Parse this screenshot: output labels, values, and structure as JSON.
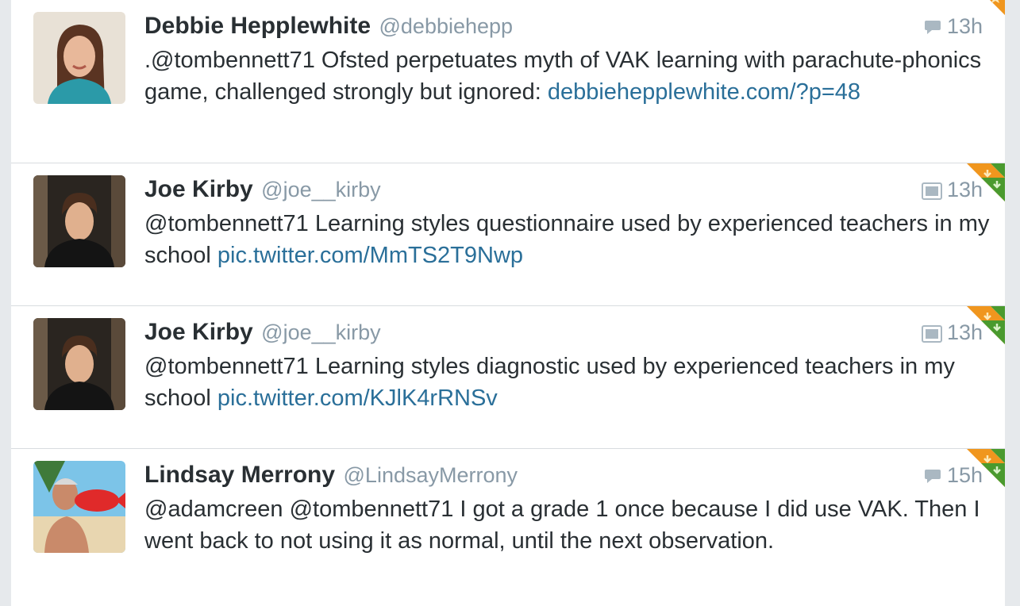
{
  "tweets": [
    {
      "name": "Debbie Hepplewhite",
      "handle": "@debbiehepp",
      "time": "13h",
      "meta_icon": "reply-bubble-icon",
      "text": ".@tombennett71 Ofsted perpetuates myth of VAK learning with parachute-phonics game, challenged strongly but ignored: ",
      "link": "debbiehepplewhite.com/?p=48",
      "corner": "favorite-star-icon"
    },
    {
      "name": "Joe Kirby",
      "handle": "@joe__kirby",
      "time": "13h",
      "meta_icon": "photo-icon",
      "text": "@tombennett71 Learning styles questionnaire used by experienced teachers in my school ",
      "link": "pic.twitter.com/MmTS2T9Nwp",
      "corner": "favorite-retweet-icon"
    },
    {
      "name": "Joe Kirby",
      "handle": "@joe__kirby",
      "time": "13h",
      "meta_icon": "photo-icon",
      "text": "@tombennett71 Learning styles diagnostic used by experienced teachers in my school ",
      "link": "pic.twitter.com/KJlK4rRNSv",
      "corner": "favorite-retweet-icon"
    },
    {
      "name": "Lindsay Merrony",
      "handle": "@LindsayMerrony",
      "time": "15h",
      "meta_icon": "reply-bubble-icon",
      "text": "@adamcreen @tombennett71 I got a grade 1 once because I did use VAK. Then I went back to not using it as normal, until the next observation.",
      "link": "",
      "corner": "favorite-retweet-icon"
    }
  ],
  "colors": {
    "link": "#2a6f99",
    "muted": "#8899a6",
    "favorite": "#f0961e",
    "retweet": "#4a9a2e"
  }
}
